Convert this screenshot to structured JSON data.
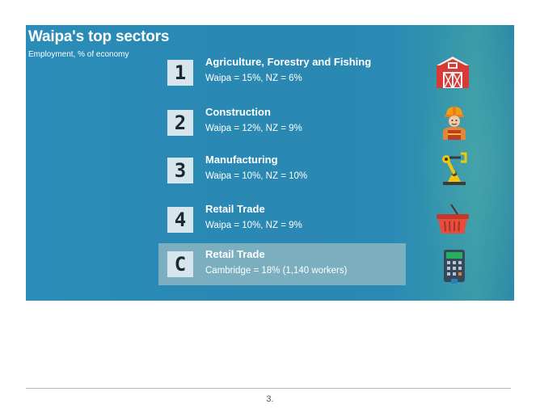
{
  "slide": {
    "title": "Waipa's top sectors",
    "subtitle": "Employment, % of economy"
  },
  "sectors": [
    {
      "rank": "1",
      "name": "Agriculture, Forestry and Fishing",
      "stat": "Waipa = 15%, NZ = 6%",
      "icon": "barn-icon"
    },
    {
      "rank": "2",
      "name": "Construction",
      "stat": "Waipa = 12%, NZ = 9%",
      "icon": "construction-worker-icon"
    },
    {
      "rank": "3",
      "name": "Manufacturing",
      "stat": "Waipa = 10%, NZ = 10%",
      "icon": "robotic-arm-icon"
    },
    {
      "rank": "4",
      "name": "Retail Trade",
      "stat": "Waipa = 10%, NZ = 9%",
      "icon": "shopping-basket-icon"
    },
    {
      "rank": "C",
      "name": "Retail Trade",
      "stat": "Cambridge = 18% (1,140 workers)",
      "icon": "cash-register-icon"
    }
  ],
  "footer": {
    "page_number": "3."
  },
  "colors": {
    "banner": "#2a8cb8",
    "number_box": "#d7e6ec",
    "highlight": "#a9c3c0",
    "text": "#ffffff"
  }
}
